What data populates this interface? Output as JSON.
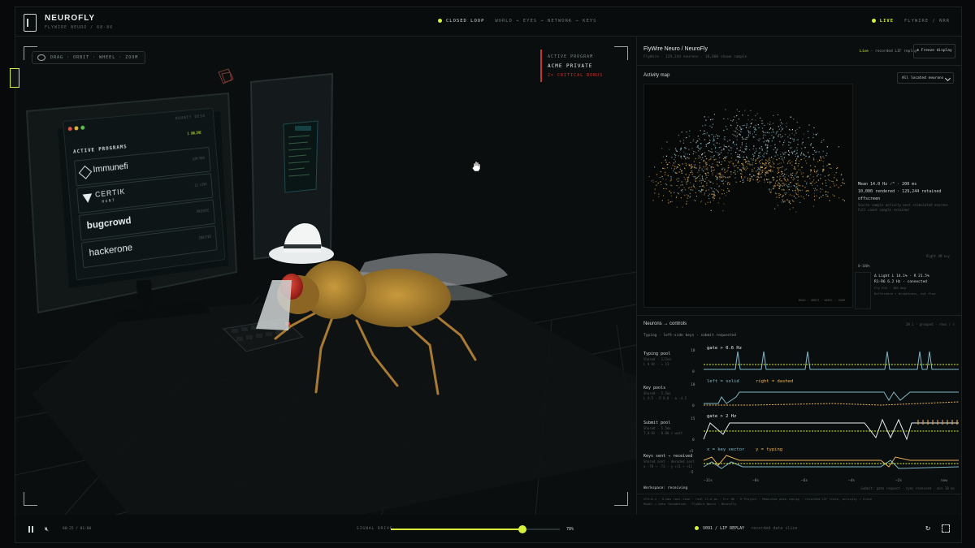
{
  "header": {
    "brand": "NEUROFLY",
    "brand_sub": "FLYWIRE NEURO / 68·86",
    "loop_label": "CLOSED LOOP",
    "loop_path": "WORLD → EYES → NETWORK → KEYS",
    "live": "LIVE",
    "right_meta": "FLYWIRE / NRR"
  },
  "viewport": {
    "orbit_hint": "DRAG · ORBIT · WHEEL · ZOOM",
    "program_key": "ACTIVE PROGRAM",
    "program_value": "ACME PRIVATE",
    "program_note": "2× CRITICAL BONUS",
    "monitor": {
      "header": "BOUNTY DESK",
      "status": "3 ONLINE",
      "title": "ACTIVE PROGRAMS",
      "programs": [
        {
          "name": "Immunefi",
          "meta": "$2M MAX"
        },
        {
          "name": "CERTIK",
          "sub": "HUNT",
          "meta": "12 LIVE"
        },
        {
          "name": "bugcrowd",
          "meta": "PRIVATE"
        },
        {
          "name": "hackerone",
          "meta": "INVITED"
        }
      ]
    }
  },
  "panel": {
    "title": "FlyWire Neuro / NeuroFly",
    "subtitle": "FlyWire · 129,244 neurons · 10,000 shown sample",
    "live_replay": "Live",
    "live_replay_rest": "· recorded LIF replay",
    "freeze": "Freeze display",
    "activity_title": "Activity map",
    "neuron_select": "All located neurons",
    "stats": {
      "mean": "Mean 14.0 Hz ⁄ᴴ · 200 ms",
      "rendered": "10,000 rendered · 129,244 retained",
      "offscreen": "offscreen",
      "note1": "Source sample activity most stimulated neurons",
      "note2": "Full count sample retained"
    },
    "scale_top": "Right 4M n×y",
    "scale_label": "0–100%",
    "gains": {
      "line1": "Δ Light L 14.1% · R 21.5%",
      "line2": "R1-R6 6.2 Hz · connected",
      "line3": "Fly FOV · 360 deg",
      "line4": "Difference → brightness, not flow"
    },
    "map_footer": "DRAG · ORBIT · WHEEL · ZOOM",
    "controls_title": "Neurons → controls",
    "controls_right": "2W 1 · grouped · rows / s",
    "typing": "Typing · left-side keys · submit requested",
    "rows": [
      {
        "label": "Typing pool",
        "meta1": "Shared · 1/2nd",
        "meta2": "L 0 Hz · ↔ 13",
        "annotation": "gate > 0.6 Hz",
        "top": "10",
        "bottom": "0"
      },
      {
        "label": "Key pools",
        "meta1": "Shared · 5.5ms",
        "meta2": "L 4.5 · R 8.0 · Δ -4.5",
        "annotation_left": "left = solid",
        "annotation_right": "right = dashed",
        "top": "10",
        "bottom": "0"
      },
      {
        "label": "Submit pool",
        "meta1": "Shared · 5.5ms",
        "meta2": "7.0 Hz · 0.00 s wait",
        "annotation": "gate > 2 Hz",
        "top": "15",
        "bottom": "0"
      },
      {
        "label": "Keys sent → received",
        "meta1": "Shared sent · decoded sent",
        "meta2": "x -78 → -73 · y +11 → +11",
        "annotation_left": "x = key vector",
        "annotation_right": "y = typing",
        "top": "+5",
        "bottom": "-5"
      }
    ],
    "time_axis": [
      "−11s",
      "−8s",
      "−6s",
      "−4s",
      "−2s",
      "now"
    ],
    "workspace": "Workspace: receiving",
    "workspace_right": "Submit: gate request · sync received · min 10 ms",
    "footnote1": "CFG·0.4 · 8.0ms real time · real 11.6 ms · Err 0K · H Project · Measured pose replay · recorded LIF trace, activity ↑ trace",
    "footnote2": "Model = data foundation · FlyWire Neuro · NeuroFly"
  },
  "bottom": {
    "time": "00:25 / 01:00",
    "signal_label": "SIGNAL DRIVE",
    "signal_value": 0.78,
    "signal_pct": "78%",
    "replay": "V091 / LIF REPLAY",
    "replay_note": "recorded data slice"
  },
  "colors": {
    "accent": "#d6f23a",
    "warn": "#c2372f",
    "warm": "#e8b25a",
    "cool": "#7fb8c7"
  }
}
